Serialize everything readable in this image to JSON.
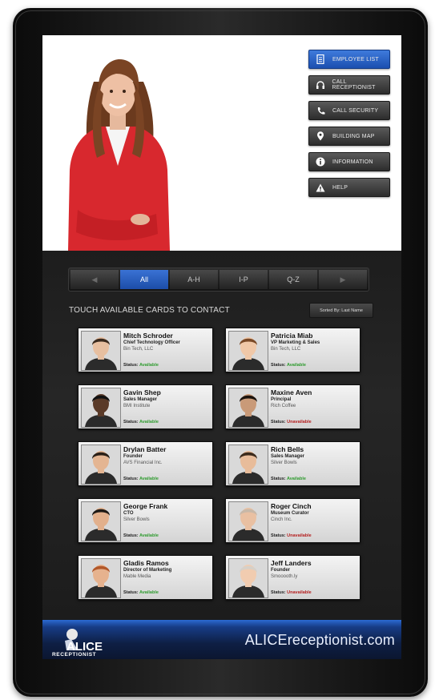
{
  "menu": [
    {
      "label": "EMPLOYEE LIST",
      "icon": "document-icon",
      "active": true
    },
    {
      "label": "CALL RECEPTIONIST",
      "icon": "headset-icon",
      "active": false
    },
    {
      "label": "CALL SECURITY",
      "icon": "phone-icon",
      "active": false
    },
    {
      "label": "BUILDING MAP",
      "icon": "map-pin-icon",
      "active": false
    },
    {
      "label": "INFORMATION",
      "icon": "info-icon",
      "active": false
    },
    {
      "label": "HELP",
      "icon": "warning-icon",
      "active": false
    }
  ],
  "tabs": {
    "prev": "◀",
    "items": [
      "All",
      "A-H",
      "I-P",
      "Q-Z"
    ],
    "active_index": 0,
    "next": "▶"
  },
  "directory": {
    "heading": "TOUCH AVAILABLE CARDS TO CONTACT",
    "sort_label": "Sorted By: Last Name",
    "status_prefix": "Status:",
    "status_colors": {
      "Available": "#2e9b2e",
      "Unavailable": "#b52020"
    }
  },
  "contacts": [
    {
      "name": "Mitch Schroder",
      "title": "Chief Technology Officer",
      "company": "Bin Tech, LLC",
      "status": "Available"
    },
    {
      "name": "Patricia Miab",
      "title": "VP Marketing & Sales",
      "company": "Bin Tech, LLC",
      "status": "Available"
    },
    {
      "name": "Gavin Shep",
      "title": "Sales Manager",
      "company": "BMI Institute",
      "status": "Available"
    },
    {
      "name": "Maxine Aven",
      "title": "Principal",
      "company": "Rich Coffee",
      "status": "Unavailable"
    },
    {
      "name": "Drylan Batter",
      "title": "Founder",
      "company": "AVS Financial Inc.",
      "status": "Available"
    },
    {
      "name": "Rich Bells",
      "title": "Sales Manager",
      "company": "Silver Bowls",
      "status": "Available"
    },
    {
      "name": "George Frank",
      "title": "CTO",
      "company": "Silver Bowls",
      "status": "Available"
    },
    {
      "name": "Roger Cinch",
      "title": "Museum Curator",
      "company": "Cinch Inc.",
      "status": "Unavailable"
    },
    {
      "name": "Gladis Ramos",
      "title": "Director of Marketing",
      "company": "Mable Media",
      "status": "Available"
    },
    {
      "name": "Jeff Landers",
      "title": "Founder",
      "company": "Smooooth.ly",
      "status": "Unavailable"
    }
  ],
  "footer": {
    "logo_text": "ALICE",
    "logo_sub": "RECEPTIONIST",
    "url": "ALICEreceptionist.com"
  }
}
